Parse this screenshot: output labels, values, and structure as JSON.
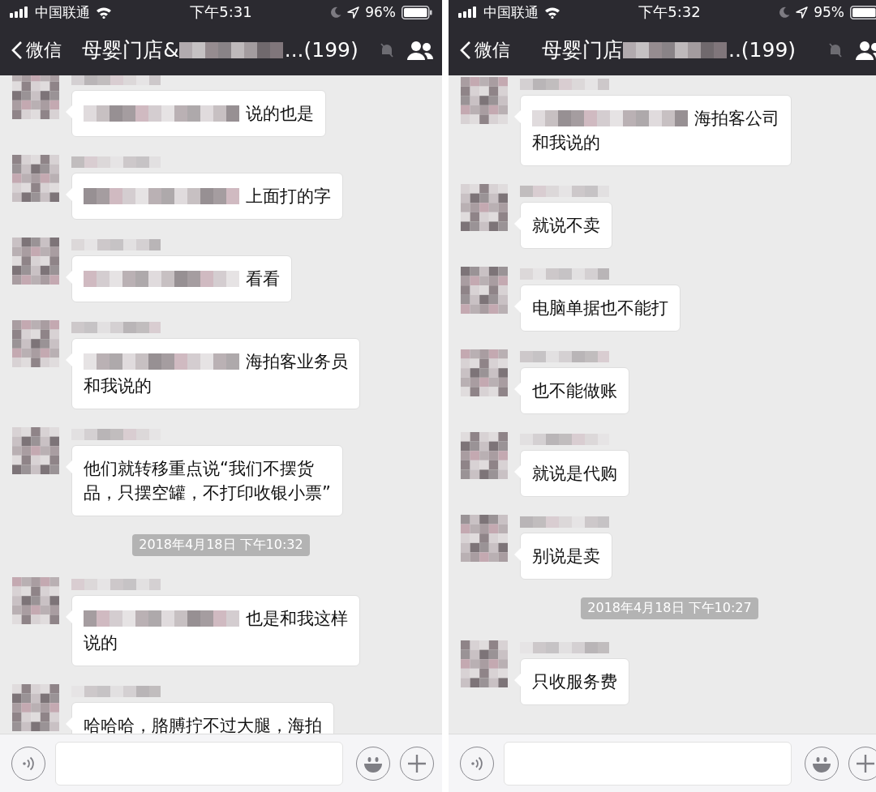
{
  "phones": [
    {
      "status_bar": {
        "carrier": "中国联通",
        "time": "下午5:31",
        "battery": "96%"
      },
      "nav": {
        "back": "微信",
        "title_start": "母婴门店&",
        "title_end": "...(199)"
      },
      "messages": [
        {
          "kind": "message",
          "mention": true,
          "lines": [
            "说的也是"
          ]
        },
        {
          "kind": "message",
          "mention": true,
          "lines": [
            "上面打的字"
          ]
        },
        {
          "kind": "message",
          "mention": true,
          "lines": [
            "看看"
          ]
        },
        {
          "kind": "message",
          "mention": true,
          "lines": [
            "海拍客业务员",
            "和我说的"
          ]
        },
        {
          "kind": "message",
          "mention": false,
          "lines": [
            "他们就转移重点说“我们不摆货",
            "品，只摆空罐，不打印收银小票”"
          ]
        },
        {
          "kind": "time",
          "text": "2018年4月18日 下午10:32"
        },
        {
          "kind": "message",
          "mention": true,
          "lines": [
            "也是和我这样",
            "说的"
          ]
        },
        {
          "kind": "message",
          "mention": false,
          "lines": [
            "哈哈哈，胳膊拧不过大腿，海拍"
          ]
        }
      ]
    },
    {
      "status_bar": {
        "carrier": "中国联通",
        "time": "下午5:32",
        "battery": "95%"
      },
      "nav": {
        "back": "微信",
        "title_start": "母婴门店",
        "title_end": "..(199)"
      },
      "messages": [
        {
          "kind": "message",
          "mention": true,
          "lines": [
            "海拍客公司",
            "和我说的"
          ]
        },
        {
          "kind": "message",
          "mention": false,
          "lines": [
            "就说不卖"
          ]
        },
        {
          "kind": "message",
          "mention": false,
          "lines": [
            "电脑单据也不能打"
          ]
        },
        {
          "kind": "message",
          "mention": false,
          "lines": [
            "也不能做账"
          ]
        },
        {
          "kind": "message",
          "mention": false,
          "lines": [
            "就说是代购"
          ]
        },
        {
          "kind": "message",
          "mention": false,
          "lines": [
            "别说是卖"
          ]
        },
        {
          "kind": "time",
          "text": "2018年4月18日 下午10:27"
        },
        {
          "kind": "message",
          "mention": false,
          "lines": [
            "只收服务费"
          ]
        }
      ]
    }
  ]
}
